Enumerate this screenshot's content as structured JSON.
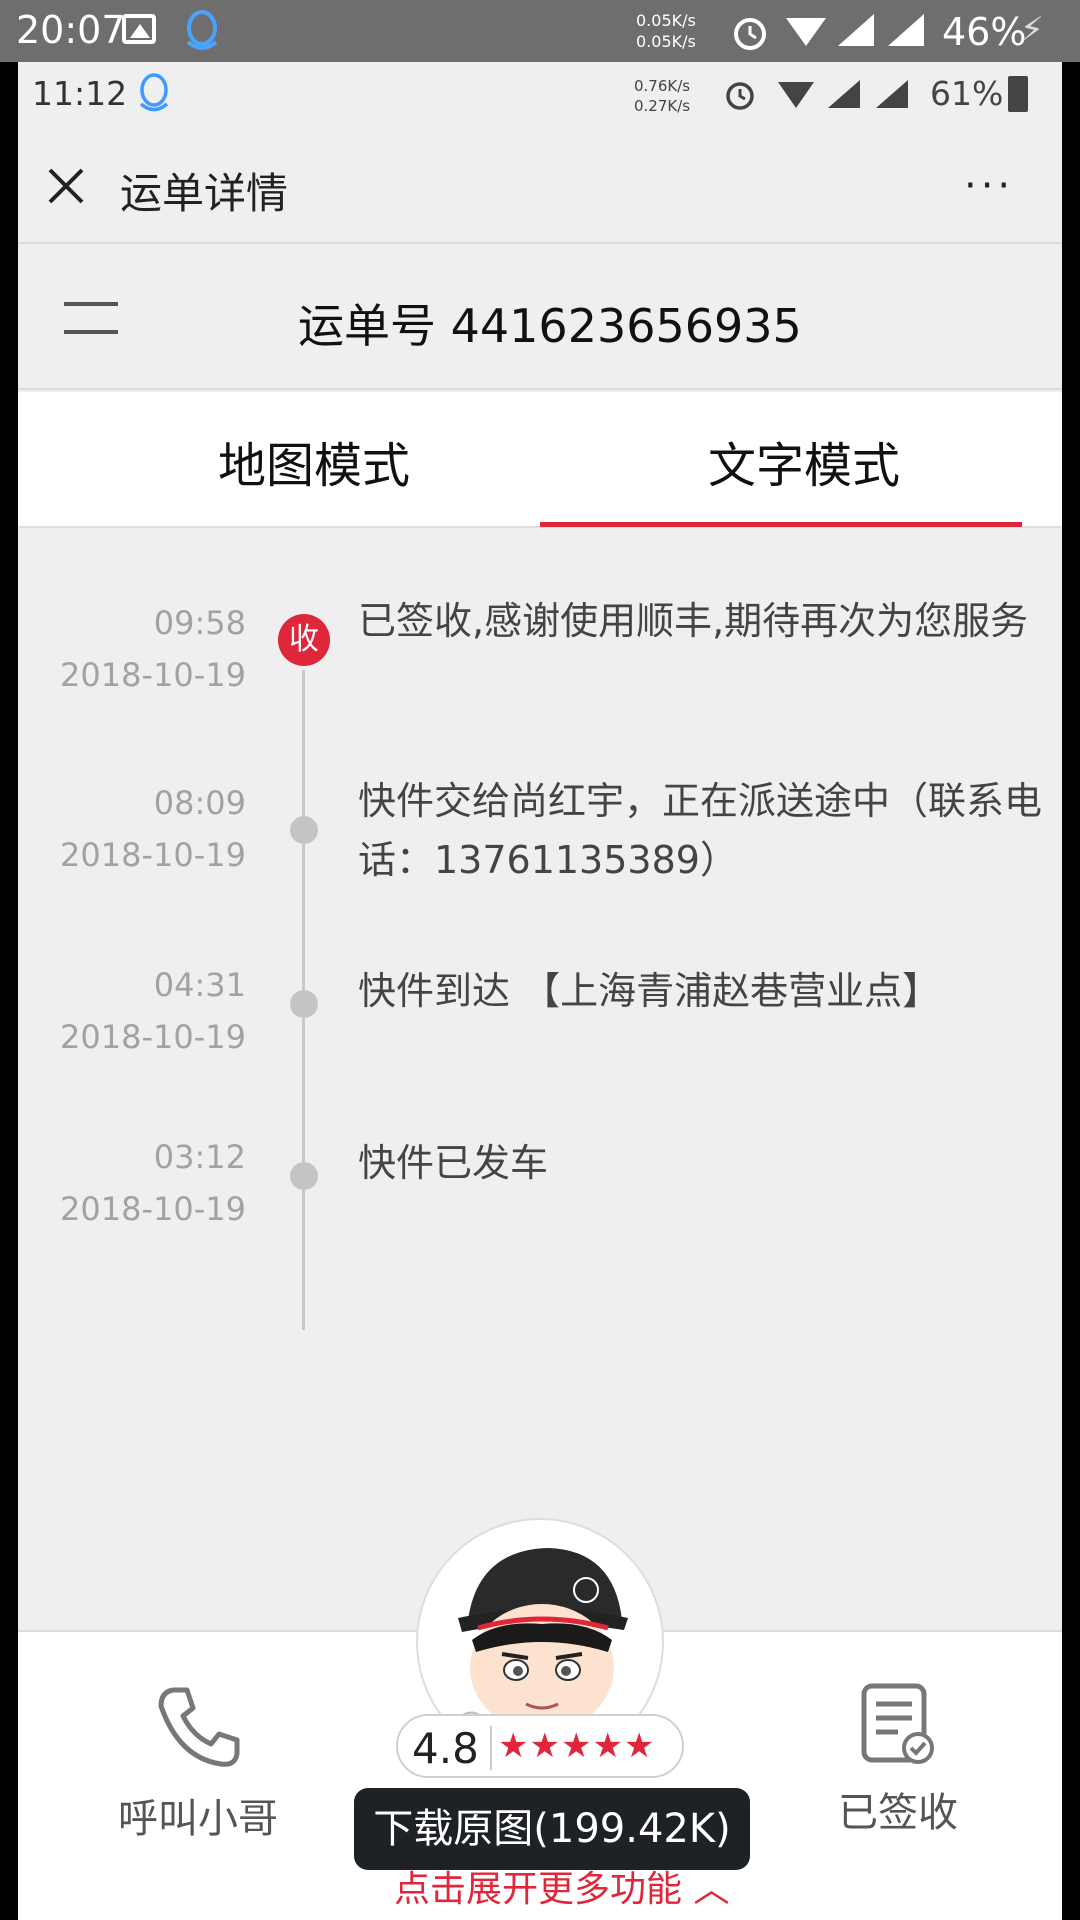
{
  "outer_status": {
    "time": "20:07",
    "net_up": "0.05K/s",
    "net_down": "0.05K/s",
    "battery": "46%"
  },
  "inner_status": {
    "time": "11:12",
    "net_up": "0.76K/s",
    "net_down": "0.27K/s",
    "battery": "61%"
  },
  "title_bar": {
    "title": "运单详情",
    "more": "···"
  },
  "waybill": {
    "label": "运单号 441623656935"
  },
  "tabs": [
    {
      "label": "地图模式",
      "active": false
    },
    {
      "label": "文字模式",
      "active": true
    }
  ],
  "timeline": [
    {
      "time": "09:58",
      "date": "2018-10-19",
      "badge": "收",
      "desc": "已签收,感谢使用顺丰,期待再次为您服务"
    },
    {
      "time": "08:09",
      "date": "2018-10-19",
      "desc": "快件交给尚红宇，正在派送途中（联系电话：13761135389）"
    },
    {
      "time": "04:31",
      "date": "2018-10-19",
      "desc": "快件到达 【上海青浦赵巷营业点】"
    },
    {
      "time": "03:12",
      "date": "2018-10-19",
      "desc": "快件已发车"
    }
  ],
  "bottom": {
    "call_label": "呼叫小哥",
    "signed_label": "已签收",
    "rating": "4.8",
    "stars": "★★★★★",
    "download_tip": "下载原图(199.42K)",
    "expand_more": "点击展开更多功能 ︿"
  },
  "colors": {
    "accent": "#e0263a",
    "background": "#efefef"
  }
}
